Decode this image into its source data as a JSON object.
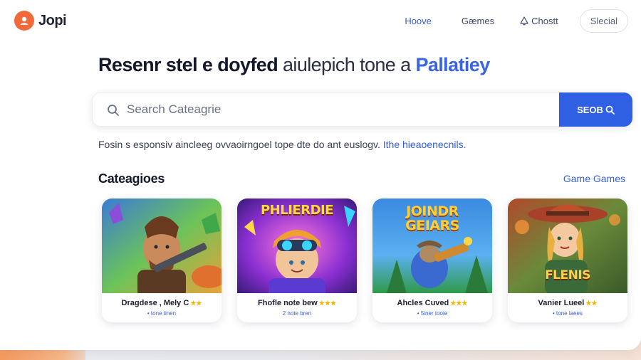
{
  "colors": {
    "accent": "#2f5fe3",
    "brand": "#f26a3b",
    "star": "#f4b400"
  },
  "brand": {
    "name": "Jopi"
  },
  "nav": {
    "home": "Hoove",
    "games": "Gæmes",
    "ghost": "Chostt",
    "button": "Slecial"
  },
  "hero": {
    "headline_main": "Resenr stel e doyfed ",
    "headline_light": "aiulepich tone a ",
    "headline_accent": "Pallatiey"
  },
  "search": {
    "placeholder": "Search Cateagrie",
    "button_label": "SEOB"
  },
  "subtitle": {
    "text": "Fosin s esponsiv aincleeg ovvaoirngoel tope dte do ant euslogv. ",
    "link": "Ithe hieaoenecnils."
  },
  "categories": {
    "title": "Cateagioes",
    "link": "Game Games",
    "cards": [
      {
        "title": "Dragdese , Mely C",
        "stars": "★★",
        "sub": "• tone tinen",
        "art_text": "",
        "icon": "warrior-with-gun"
      },
      {
        "title": "Fhofle note bew",
        "stars": "★★★",
        "sub": "2 note bren",
        "art_text": "PHLIERDIE",
        "icon": "goggles-hero"
      },
      {
        "title": "Ahcles Cuved",
        "stars": "★★★",
        "sub": "• 5iner tooie",
        "art_text": "JOINDR GEIARS",
        "icon": "creature-with-blaster"
      },
      {
        "title": "Vanier Lueel",
        "stars": "★★",
        "sub": "• tone laees",
        "art_text": "FLENIS",
        "icon": "cowgirl-adventurer"
      }
    ]
  }
}
